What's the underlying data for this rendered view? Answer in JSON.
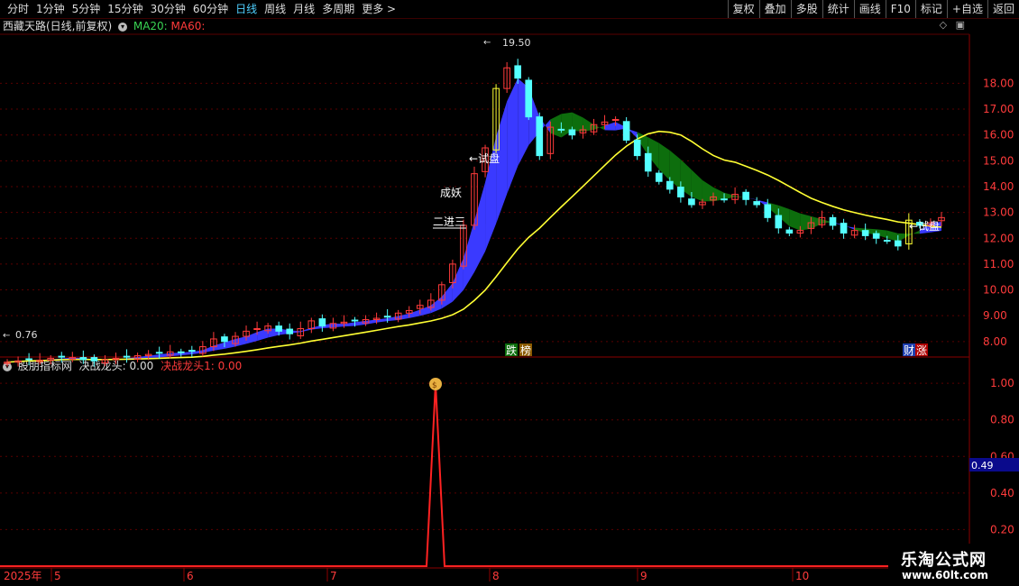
{
  "toolbar": {
    "periods": [
      "分时",
      "1分钟",
      "5分钟",
      "15分钟",
      "30分钟",
      "60分钟",
      "日线",
      "周线",
      "月线",
      "多周期",
      "更多 >"
    ],
    "active": "日线",
    "buttons": [
      "复权",
      "叠加",
      "多股",
      "统计",
      "画线",
      "F10",
      "标记",
      "+自选",
      "返回"
    ]
  },
  "main_header": {
    "title": "西藏天路(日线,前复权)",
    "ma20": "MA20:",
    "ma60": "MA60:"
  },
  "sub_header": {
    "title": "股朋指标网",
    "ind1": "决战龙头: 0.00",
    "ind2": "决战龙头1: 0.00",
    "current_value": "0.49"
  },
  "annotations": {
    "high_label": "19.50",
    "low_label": "0.76",
    "trial1": "←试盘",
    "trial2": "←试盘",
    "monster": "成妖",
    "two_to_three": "二进三",
    "tag_drop": "跌",
    "tag_list": "榜",
    "tag_fin": "财",
    "tag_rise": "涨"
  },
  "axis": {
    "price_ticks": [
      "18.00",
      "17.00",
      "16.00",
      "15.00",
      "14.00",
      "13.00",
      "12.00",
      "11.00",
      "10.00",
      "9.00",
      "8.00"
    ],
    "ind_ticks": [
      "1.00",
      "0.80",
      "0.60",
      "0.40",
      "0.20"
    ],
    "year_label": "2025年",
    "months": [
      "5",
      "6",
      "7",
      "8",
      "9",
      "10"
    ]
  },
  "watermark": {
    "line1": "乐淘公式网",
    "line2": "www.60lt.com"
  },
  "colors": {
    "up": "#ff3b3b",
    "down": "#54ffff",
    "ribbon_up": "#3a3aff",
    "ribbon_down": "#0d6e0d",
    "ma60_line": "#ffff33"
  },
  "chart_data": {
    "type": "candlestick",
    "y_range": [
      7.4,
      19.9
    ],
    "ind_range": [
      0.0,
      1.05
    ],
    "close_series": [
      7.2,
      7.25,
      7.3,
      7.28,
      7.35,
      7.4,
      7.38,
      7.3,
      7.25,
      7.3,
      7.35,
      7.4,
      7.45,
      7.5,
      7.55,
      7.6,
      7.58,
      7.62,
      7.8,
      8.1,
      8.0,
      8.2,
      8.4,
      8.5,
      8.6,
      8.4,
      8.3,
      8.5,
      8.8,
      8.6,
      8.7,
      8.75,
      8.8,
      8.85,
      8.9,
      8.95,
      9.1,
      9.2,
      9.4,
      9.6,
      10.2,
      11.0,
      12.5,
      14.5,
      15.5,
      17.8,
      18.6,
      18.2,
      16.7,
      15.2,
      16.3,
      16.2,
      16.0,
      16.2,
      16.4,
      16.5,
      16.6,
      15.8,
      15.2,
      14.6,
      14.2,
      13.9,
      13.6,
      13.3,
      13.4,
      13.6,
      13.5,
      13.7,
      13.5,
      13.3,
      12.8,
      12.4,
      12.2,
      12.3,
      12.6,
      12.8,
      12.5,
      12.2,
      12.3,
      12.1,
      12.0,
      11.9,
      11.7,
      12.7,
      12.5,
      12.6,
      12.8
    ],
    "indicator_spike": {
      "x_index": 44,
      "value": 1.0
    }
  }
}
